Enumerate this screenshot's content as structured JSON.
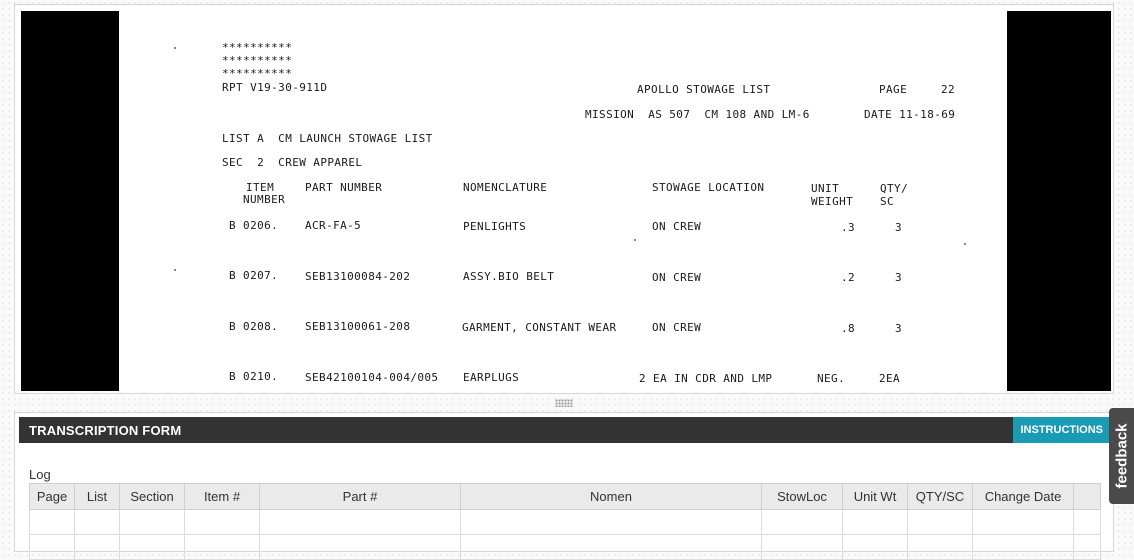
{
  "document": {
    "stars": [
      "**********",
      "**********",
      "**********"
    ],
    "report_id": "RPT V19-30-911D",
    "list_title": "APOLLO STOWAGE LIST",
    "page_label": "PAGE",
    "page_number": "22",
    "mission_line": "MISSION  AS 507  CM 108 AND LM-6",
    "date_line": "DATE 11-18-69",
    "list_line": "LIST A  CM LAUNCH STOWAGE LIST",
    "section_line": "SEC  2  CREW APPAREL",
    "headers": {
      "item": "ITEM",
      "item2": "NUMBER",
      "part": "PART NUMBER",
      "nomen": "NOMENCLATURE",
      "stowloc": "STOWAGE LOCATION",
      "unit": "UNIT",
      "unit2": "WEIGHT",
      "qty": "QTY/",
      "qty2": "SC"
    },
    "rows": [
      {
        "item": "B 0206.",
        "part": "ACR-FA-5",
        "nomen": "PENLIGHTS",
        "loc": "ON CREW",
        "weight": ".3",
        "qty": "3"
      },
      {
        "item": "B 0207.",
        "part": "SEB13100084-202",
        "nomen": "ASSY.BIO BELT",
        "loc": "ON CREW",
        "weight": ".2",
        "qty": "3"
      },
      {
        "item": "B 0208.",
        "part": "SEB13100061-208",
        "nomen": "GARMENT, CONSTANT WEAR",
        "loc": "ON CREW",
        "weight": ".8",
        "qty": "3"
      },
      {
        "item": "B 0210.",
        "part": "SEB42100104-004/005",
        "nomen": "EARPLUGS",
        "loc": "2 EA IN CDR AND LMP",
        "weight": "NEG.",
        "qty": "2EA"
      }
    ]
  },
  "form": {
    "title": "TRANSCRIPTION FORM",
    "instructions_label": "INSTRUCTIONS",
    "log_label": "Log",
    "columns": [
      "Page",
      "List",
      "Section",
      "Item #",
      "Part #",
      "Nomen",
      "StowLoc",
      "Unit Wt",
      "QTY/SC",
      "Change Date"
    ]
  },
  "feedback_label": "feedback"
}
